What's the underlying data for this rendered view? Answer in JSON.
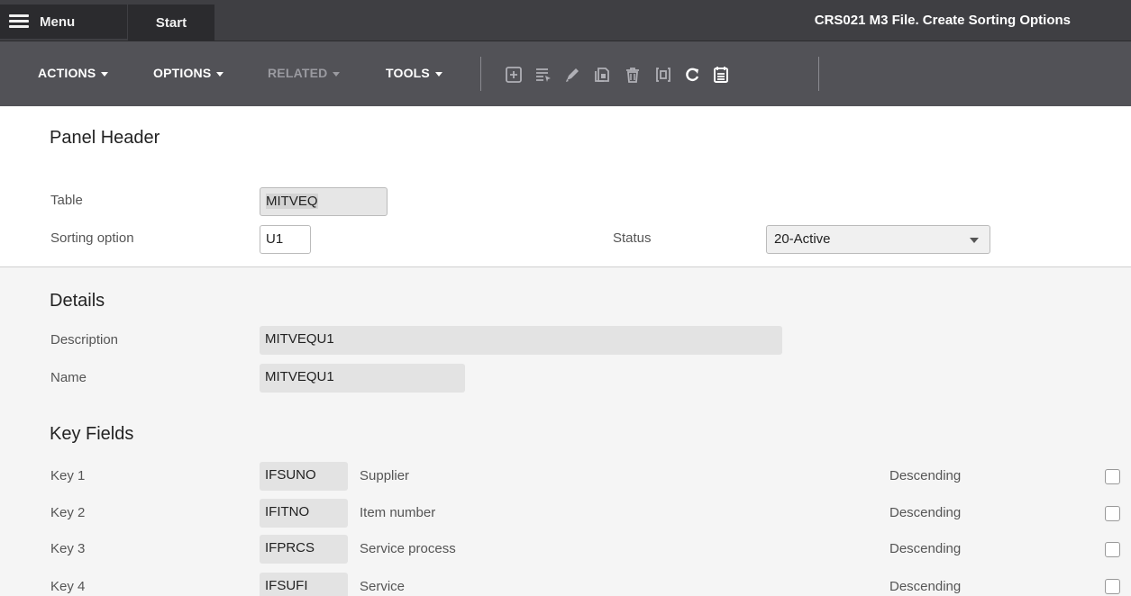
{
  "topbar": {
    "menu_label": "Menu",
    "start_tab": "Start",
    "title": "CRS021 M3 File. Create Sorting Options"
  },
  "toolbar": {
    "actions": "ACTIONS",
    "options": "OPTIONS",
    "related": "RELATED",
    "tools": "TOOLS",
    "icons": [
      "add-icon",
      "select-list-icon",
      "edit-pencil-icon",
      "copy-icon",
      "delete-icon",
      "display-icon",
      "refresh-icon",
      "calendar-icon"
    ]
  },
  "panel_header": {
    "title": "Panel Header",
    "table_label": "Table",
    "table_value": "MITVEQ",
    "sorting_label": "Sorting option",
    "sorting_value": "U1",
    "status_label": "Status",
    "status_value": "20-Active"
  },
  "details": {
    "title": "Details",
    "description_label": "Description",
    "description_value": "MITVEQU1",
    "name_label": "Name",
    "name_value": "MITVEQU1"
  },
  "key_fields": {
    "title": "Key Fields",
    "rows": [
      {
        "label": "Key 1",
        "field": "IFSUNO",
        "desc": "Supplier",
        "order": "Descending"
      },
      {
        "label": "Key 2",
        "field": "IFITNO",
        "desc": "Item number",
        "order": "Descending"
      },
      {
        "label": "Key 3",
        "field": "IFPRCS",
        "desc": "Service process",
        "order": "Descending"
      },
      {
        "label": "Key 4",
        "field": "IFSUFI",
        "desc": "Service",
        "order": "Descending"
      }
    ]
  },
  "colors": {
    "topbar_bg": "#3f3f43",
    "toolbar_bg": "#525257",
    "details_bg": "#f5f5f5"
  }
}
